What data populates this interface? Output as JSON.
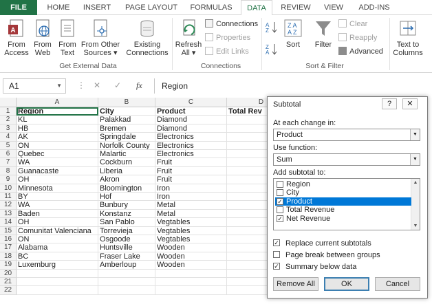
{
  "tabs": [
    "FILE",
    "HOME",
    "INSERT",
    "PAGE LAYOUT",
    "FORMULAS",
    "DATA",
    "REVIEW",
    "VIEW",
    "ADD-INS"
  ],
  "ribbon": {
    "from_access": [
      "From",
      "Access"
    ],
    "from_web": [
      "From",
      "Web"
    ],
    "from_text": [
      "From",
      "Text"
    ],
    "from_other": [
      "From Other",
      "Sources ▾"
    ],
    "existing": [
      "Existing",
      "Connections"
    ],
    "group_external": "Get External Data",
    "refresh": [
      "Refresh",
      "All ▾"
    ],
    "connections": "Connections",
    "properties": "Properties",
    "edit_links": "Edit Links",
    "group_connections": "Connections",
    "sort": "Sort",
    "filter": "Filter",
    "clear": "Clear",
    "reapply": "Reapply",
    "advanced": "Advanced",
    "group_sort": "Sort & Filter",
    "text_to_columns": [
      "Text to",
      "Columns"
    ]
  },
  "formula_bar": {
    "name_box": "A1",
    "fx": "fx",
    "content": "Region"
  },
  "grid": {
    "columns": [
      "A",
      "B",
      "C",
      "D"
    ],
    "headers": [
      "Region",
      "City",
      "Product",
      "Total Rev"
    ],
    "rows": [
      [
        "KL",
        "Palakkad",
        "Diamond"
      ],
      [
        "HB",
        "Bremen",
        "Diamond"
      ],
      [
        "AK",
        "Springdale",
        "Electronics"
      ],
      [
        "ON",
        "Norfolk County",
        "Electronics"
      ],
      [
        "Quebec",
        "Malartic",
        "Electronics"
      ],
      [
        "WA",
        "Cockburn",
        "Fruit"
      ],
      [
        "Guanacaste",
        "Liberia",
        "Fruit"
      ],
      [
        "OH",
        "Akron",
        "Fruit"
      ],
      [
        "Minnesota",
        "Bloomington",
        "Iron"
      ],
      [
        "BY",
        "Hof",
        "Iron"
      ],
      [
        "WA",
        "Bunbury",
        "Metal"
      ],
      [
        "Baden",
        "Konstanz",
        "Metal"
      ],
      [
        "OH",
        "San Pablo",
        "Vegtables"
      ],
      [
        "Comunitat Valenciana",
        "Torrevieja",
        "Vegtables"
      ],
      [
        "ON",
        "Osgoode",
        "Vegtables"
      ],
      [
        "Alabama",
        "Huntsville",
        "Wooden"
      ],
      [
        "BC",
        "Fraser Lake",
        "Wooden"
      ],
      [
        "Luxemburg",
        "Amberloup",
        "Wooden"
      ]
    ],
    "row_numbers": [
      "1",
      "2",
      "3",
      "4",
      "5",
      "6",
      "7",
      "8",
      "9",
      "10",
      "11",
      "12",
      "13",
      "14",
      "15",
      "16",
      "17",
      "18",
      "19",
      "20",
      "21",
      "22"
    ]
  },
  "dialog": {
    "title": "Subtotal",
    "help": "?",
    "close": "✕",
    "change_label": "At each change in:",
    "change_value": "Product",
    "function_label": "Use function:",
    "function_value": "Sum",
    "add_label": "Add subtotal to:",
    "fields": [
      {
        "label": "Region",
        "checked": false
      },
      {
        "label": "City",
        "checked": false
      },
      {
        "label": "Product",
        "checked": true
      },
      {
        "label": "Total Revenue",
        "checked": false
      },
      {
        "label": "Net Revenue",
        "checked": true
      }
    ],
    "replace": "Replace current subtotals",
    "page_break": "Page break between groups",
    "summary": "Summary below data",
    "remove_all": "Remove All",
    "ok": "OK",
    "cancel": "Cancel"
  },
  "colors": {
    "excel_green": "#217346",
    "selection": "#0078d7"
  }
}
